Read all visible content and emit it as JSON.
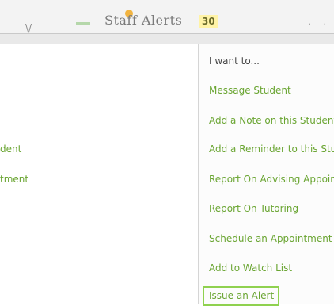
{
  "header": {
    "title": "Staff Alerts",
    "alert_count": "30",
    "tab_glyph": "\\/",
    "tool_glyphs": "· ·"
  },
  "left_list": {
    "items": [
      "dent",
      "tment"
    ]
  },
  "actions_menu": {
    "title": "I want to...",
    "items": [
      "Message Student",
      "Add a Note on this Student",
      "Add a Reminder to this Student",
      "Report On Advising Appointment",
      "Report On Tutoring",
      "Schedule an Appointment",
      "Add to Watch List",
      "Issue an Alert"
    ],
    "highlighted_item": "Issue an Alert"
  },
  "colors": {
    "link_green": "#6aa532",
    "highlight_border": "#8fd14f",
    "title_gray": "#444444",
    "badge_yellow": "#fff3a6"
  }
}
